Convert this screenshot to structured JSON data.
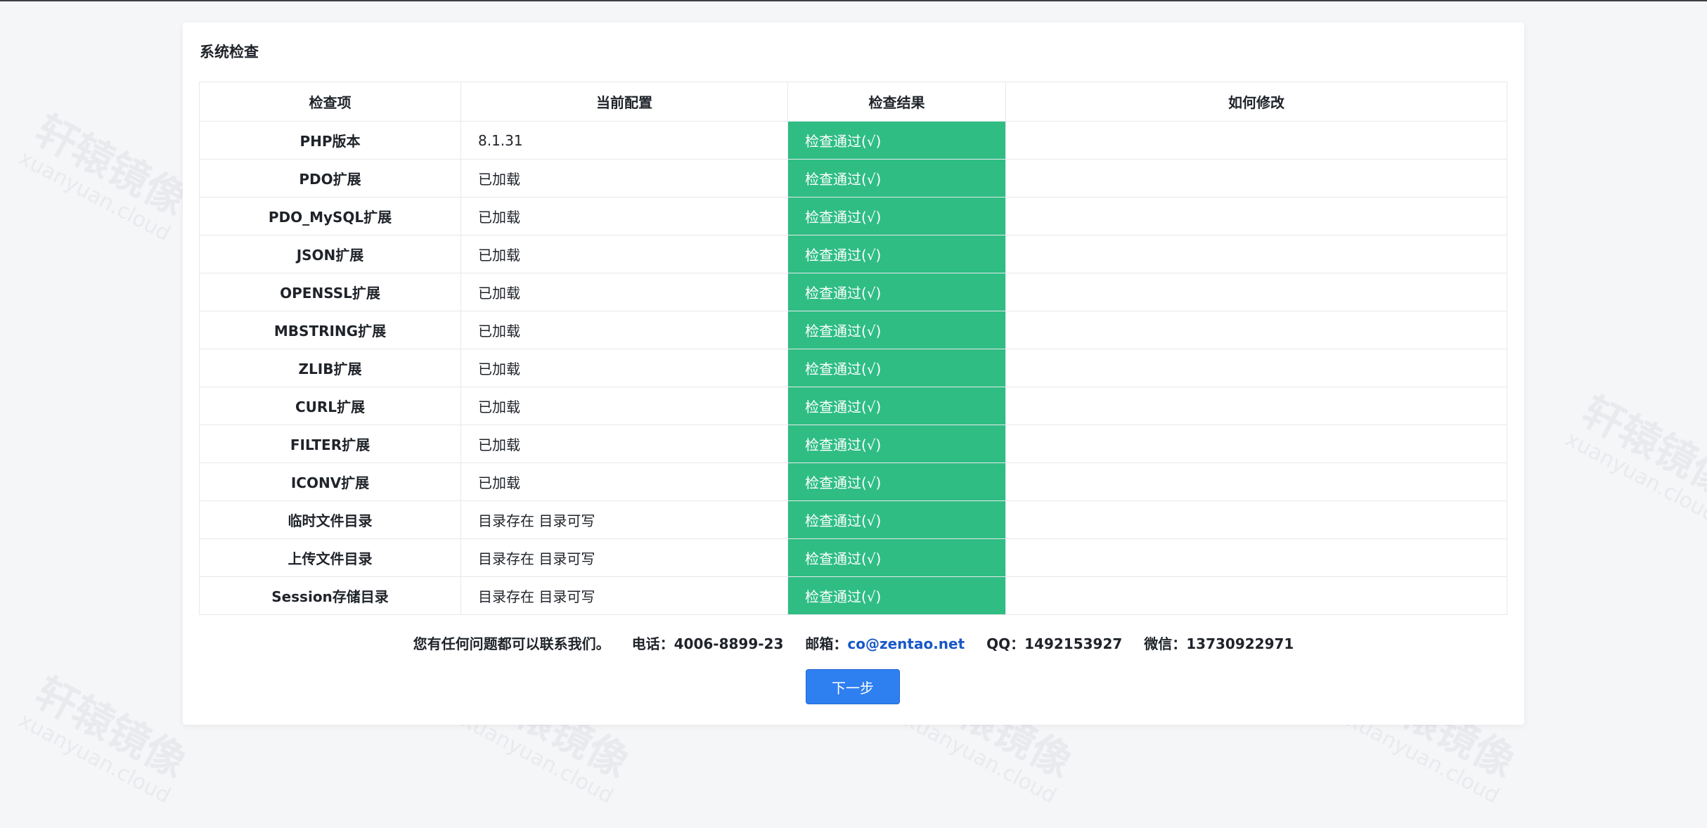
{
  "section_title": "系统检查",
  "table": {
    "headers": [
      "检查项",
      "当前配置",
      "检查结果",
      "如何修改"
    ],
    "rows": [
      {
        "item": "PHP版本",
        "config": "8.1.31",
        "result": "检查通过(√)",
        "fix": ""
      },
      {
        "item": "PDO扩展",
        "config": "已加载",
        "result": "检查通过(√)",
        "fix": ""
      },
      {
        "item": "PDO_MySQL扩展",
        "config": "已加载",
        "result": "检查通过(√)",
        "fix": ""
      },
      {
        "item": "JSON扩展",
        "config": "已加载",
        "result": "检查通过(√)",
        "fix": ""
      },
      {
        "item": "OPENSSL扩展",
        "config": "已加载",
        "result": "检查通过(√)",
        "fix": ""
      },
      {
        "item": "MBSTRING扩展",
        "config": "已加载",
        "result": "检查通过(√)",
        "fix": ""
      },
      {
        "item": "ZLIB扩展",
        "config": "已加载",
        "result": "检查通过(√)",
        "fix": ""
      },
      {
        "item": "CURL扩展",
        "config": "已加载",
        "result": "检查通过(√)",
        "fix": ""
      },
      {
        "item": "FILTER扩展",
        "config": "已加载",
        "result": "检查通过(√)",
        "fix": ""
      },
      {
        "item": "ICONV扩展",
        "config": "已加载",
        "result": "检查通过(√)",
        "fix": ""
      },
      {
        "item": "临时文件目录",
        "config": "目录存在 目录可写",
        "result": "检查通过(√)",
        "fix": ""
      },
      {
        "item": "上传文件目录",
        "config": "目录存在 目录可写",
        "result": "检查通过(√)",
        "fix": ""
      },
      {
        "item": "Session存储目录",
        "config": "目录存在 目录可写",
        "result": "检查通过(√)",
        "fix": ""
      }
    ]
  },
  "contact": {
    "intro": "您有任何问题都可以联系我们。",
    "phone": "电话：4006-8899-23",
    "email_label": "邮箱：",
    "email": "co@zentao.net",
    "qq": "QQ：1492153927",
    "wechat": "微信：13730922971"
  },
  "next_button": "下一步",
  "watermark": {
    "cn": "轩辕镜像",
    "en": "xuanyuan.cloud"
  },
  "colors": {
    "pass": "#2fbd84",
    "primary": "#2e7ff0",
    "link": "#1858c9"
  }
}
